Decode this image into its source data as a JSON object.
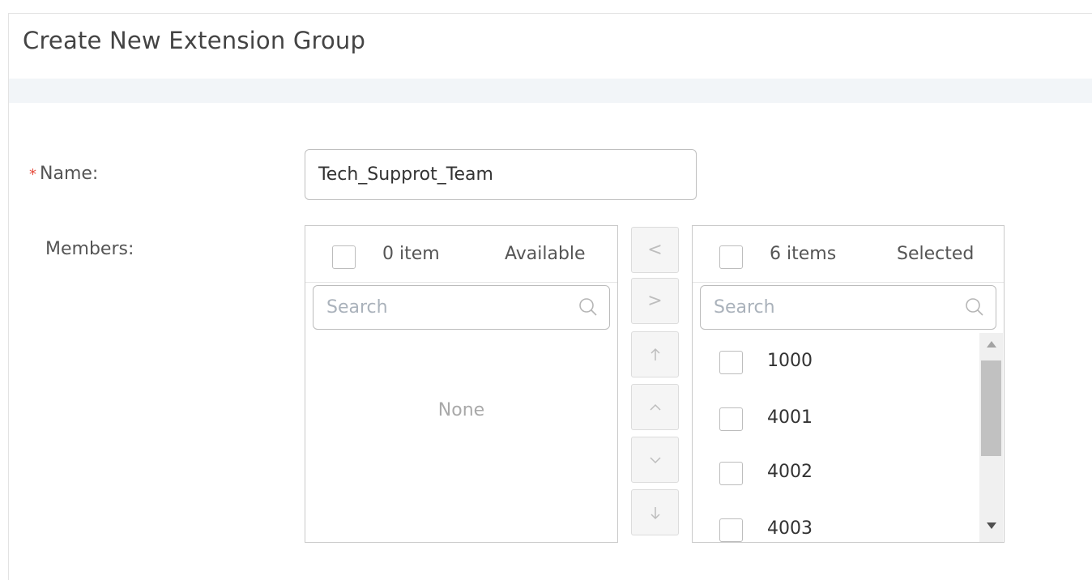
{
  "dialog": {
    "title": "Create New Extension Group"
  },
  "form": {
    "name_required_mark": "*",
    "name_label": "Name:",
    "name_value": "Tech_Supprot_Team",
    "members_label": "Members:"
  },
  "available_list": {
    "count_text": "0 item",
    "title": "Available",
    "search_placeholder": "Search",
    "empty_text": "None"
  },
  "selected_list": {
    "count_text": "6 items",
    "title": "Selected",
    "search_placeholder": "Search",
    "items": [
      {
        "label": "1000"
      },
      {
        "label": "4001"
      },
      {
        "label": "4002"
      },
      {
        "label": "4003"
      }
    ]
  },
  "transfer_buttons": {
    "move_left_glyph": "<",
    "move_right_glyph": ">"
  },
  "icons": {
    "search": "search-icon",
    "arrow_up": "arrow-up-icon",
    "chevron_up": "chevron-up-icon",
    "chevron_down": "chevron-down-icon",
    "arrow_down": "arrow-down-icon"
  },
  "colors": {
    "required_star": "#e64b3c",
    "header_band": "#f2f5f8",
    "disabled_button": "#f5f5f5"
  }
}
